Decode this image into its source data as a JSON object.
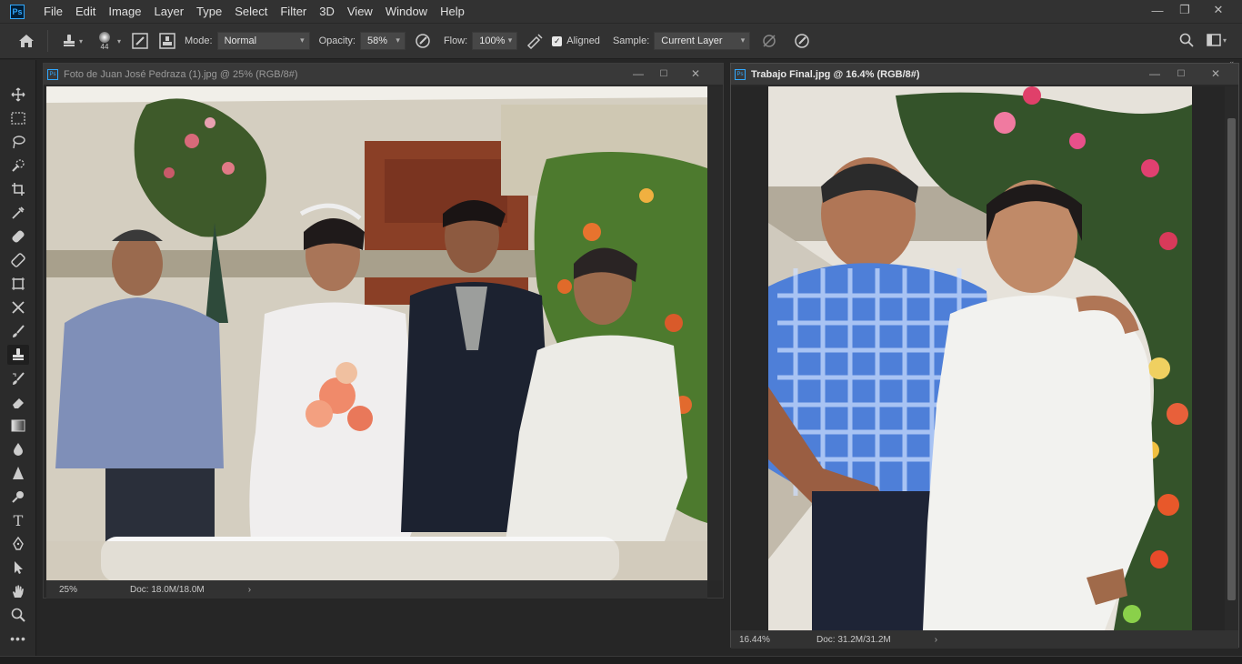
{
  "app": {
    "logo": "Ps"
  },
  "menu": [
    "File",
    "Edit",
    "Image",
    "Layer",
    "Type",
    "Select",
    "Filter",
    "3D",
    "View",
    "Window",
    "Help"
  ],
  "window_controls": {
    "minimize": "—",
    "restore": "❐",
    "close": "✕"
  },
  "options": {
    "brush_size": "44",
    "mode_label": "Mode:",
    "mode_value": "Normal",
    "opacity_label": "Opacity:",
    "opacity_value": "58%",
    "flow_label": "Flow:",
    "flow_value": "100%",
    "aligned_label": "Aligned",
    "aligned_checked": true,
    "sample_label": "Sample:",
    "sample_value": "Current Layer"
  },
  "documents": [
    {
      "title": "Foto de Juan José Pedraza (1).jpg @ 25% (RGB/8#)",
      "zoom": "25%",
      "doc_size": "Doc: 18.0M/18.0M",
      "active": false
    },
    {
      "title": "Trabajo Final.jpg @ 16.4% (RGB/8#)",
      "zoom": "16.44%",
      "doc_size": "Doc: 31.2M/31.2M",
      "active": true
    }
  ],
  "tools": [
    "move-tool",
    "marquee-tool",
    "lasso-tool",
    "quick-selection-tool",
    "crop-tool",
    "eyedropper-tool",
    "healing-brush-tool",
    "patch-tool",
    "frame-tool",
    "content-aware-move-tool",
    "brush-tool",
    "clone-stamp-tool",
    "history-brush-tool",
    "eraser-tool",
    "gradient-tool",
    "blur-tool",
    "sharpen-tool",
    "dodge-tool",
    "type-tool",
    "pen-tool",
    "path-selection-tool",
    "hand-tool",
    "zoom-tool",
    "more-tools"
  ],
  "colors": {
    "accent": "#31a8ff",
    "bg": "#262626",
    "panel": "#323232"
  }
}
